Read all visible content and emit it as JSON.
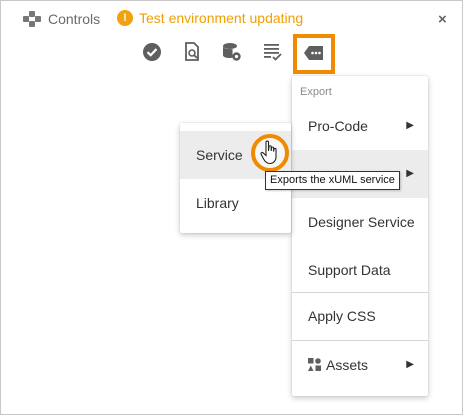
{
  "header": {
    "controls_label": "Controls",
    "env_warning": "Test environment updating",
    "warning_glyph": "!",
    "close_glyph": "×"
  },
  "toolbar": {
    "icons": [
      "check-circle-icon",
      "find-in-file-icon",
      "database-settings-icon",
      "list-check-icon",
      "export-tag-icon"
    ],
    "active_icon": "export-tag-icon"
  },
  "menu": {
    "header": "Export",
    "items": [
      {
        "label": "Pro-Code",
        "has_submenu": true
      },
      {
        "label": "",
        "has_submenu": true,
        "highlighted": true
      },
      {
        "label": "Designer Service",
        "has_submenu": false
      },
      {
        "label": "Support Data",
        "has_submenu": false
      },
      {
        "label": "Apply CSS",
        "has_submenu": false
      },
      {
        "label": "Assets",
        "has_submenu": true,
        "icon": "assets-icon"
      }
    ],
    "submenu_arrow": "▶"
  },
  "submenu": {
    "items": [
      {
        "label": "Service",
        "highlighted": true
      },
      {
        "label": "Library"
      }
    ]
  },
  "tooltip": {
    "text": "Exports the xUML service"
  },
  "colors": {
    "accent": "#f08a00",
    "warning": "#f2a20c",
    "highlight_bg": "#ececec",
    "icon_gray": "#5f5f5f"
  }
}
